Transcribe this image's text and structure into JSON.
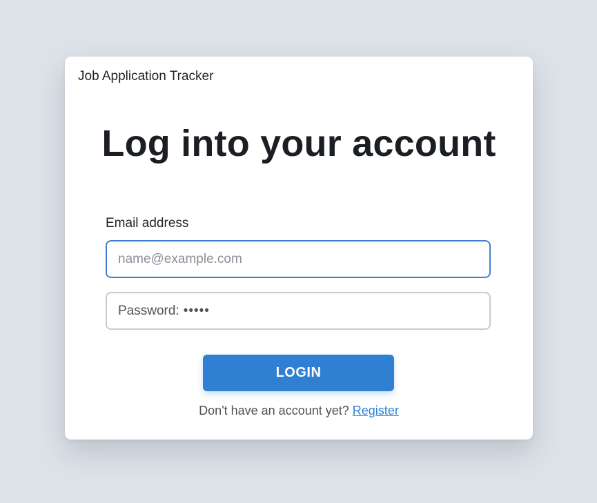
{
  "app": {
    "title": "Job Application Tracker"
  },
  "login": {
    "heading": "Log into your account",
    "email_label": "Email address",
    "email_placeholder": "name@example.com",
    "password_label": "Password:",
    "password_dots": "•••••",
    "login_button": "LOGIN",
    "register_prompt": "Don't have an account yet?",
    "register_link": "Register"
  },
  "colors": {
    "background": "#dde2e8",
    "card": "#ffffff",
    "accent": "#2f7fd3",
    "focus_border": "#3f7fd0"
  }
}
